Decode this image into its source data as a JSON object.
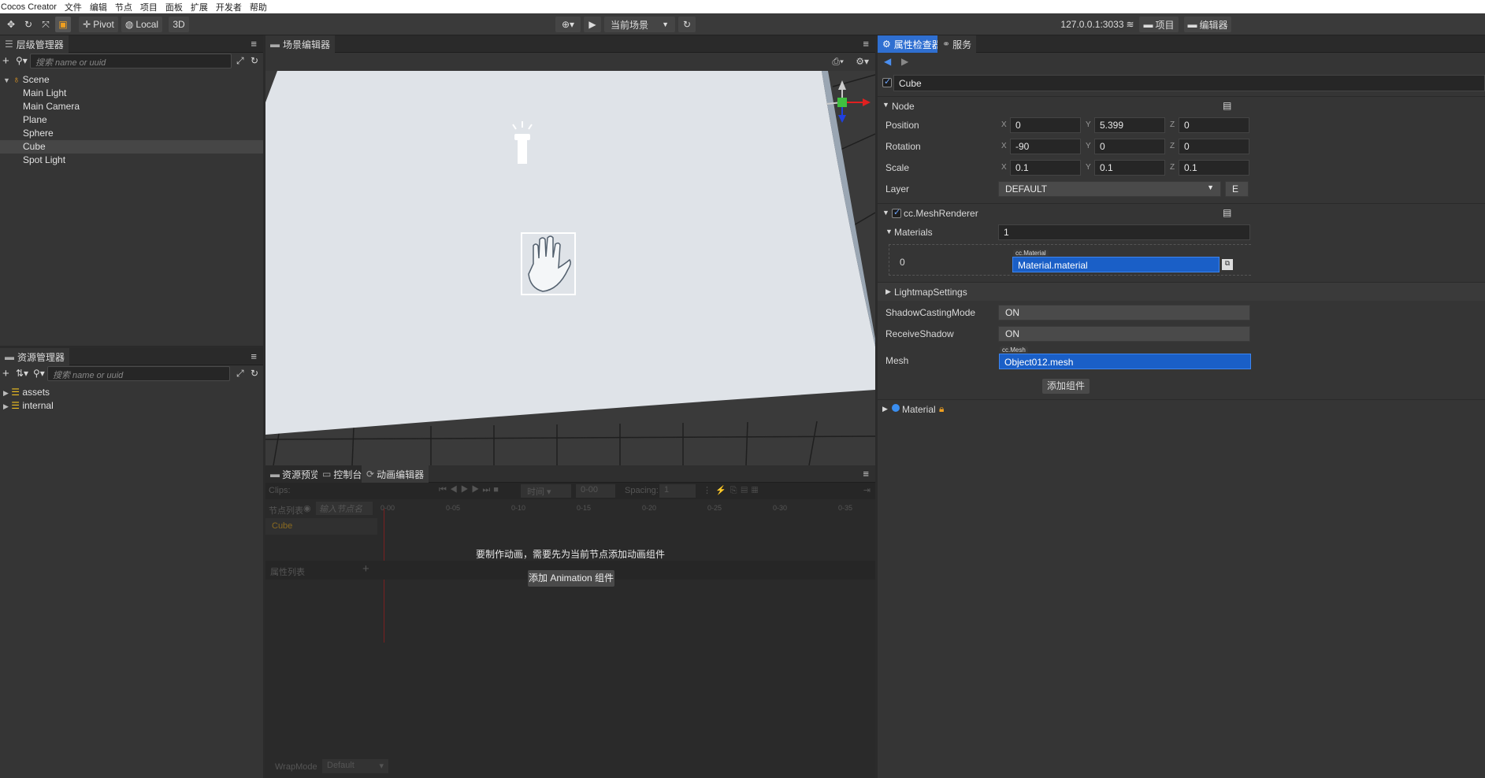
{
  "menubar": {
    "app_name": "Cocos Creator",
    "items": [
      "文件",
      "编辑",
      "节点",
      "项目",
      "面板",
      "扩展",
      "开发者",
      "帮助"
    ]
  },
  "toolbar": {
    "pivot_label": "Pivot",
    "local_label": "Local",
    "mode_3d_label": "3D",
    "scene_select": "当前场景",
    "server_address": "127.0.0.1:3033",
    "project_label": "项目",
    "editor_label": "编辑器"
  },
  "hierarchy": {
    "tab_label": "层级管理器",
    "search_placeholder": "搜索 name or uuid",
    "root": "Scene",
    "children": [
      "Main Light",
      "Main Camera",
      "Plane",
      "Sphere",
      "Cube",
      "Spot Light"
    ],
    "selected": "Cube"
  },
  "assets": {
    "tab_label": "资源管理器",
    "search_placeholder": "搜索 name or uuid",
    "items": [
      "assets",
      "internal"
    ]
  },
  "scene": {
    "tab_label": "场景编辑器"
  },
  "bottom_panel": {
    "tabs": [
      "资源预览",
      "控制台",
      "动画编辑器"
    ],
    "active_tab": "动画编辑器",
    "clips_label": "Clips:",
    "time_select": "时间",
    "time_value": "0-00",
    "spacing_label": "Spacing:",
    "spacing_value": "1",
    "node_list_label": "节点列表",
    "node_filter_placeholder": "输入节点名",
    "node_name": "Cube",
    "timeline_ticks": [
      "0-00",
      "0-05",
      "0-10",
      "0-15",
      "0-20",
      "0-25",
      "0-30",
      "0-35"
    ],
    "property_list_label": "属性列表",
    "message": "要制作动画，需要先为当前节点添加动画组件",
    "add_button": "添加 Animation 组件",
    "wrapmode_label": "WrapMode",
    "wrapmode_value": "Default"
  },
  "inspector": {
    "tabs": [
      "属性检查器",
      "服务"
    ],
    "active_tab": "属性检查器",
    "node_name": "Cube",
    "node_section": "Node",
    "position_label": "Position",
    "position": {
      "x": "0",
      "y": "5.399",
      "z": "0"
    },
    "rotation_label": "Rotation",
    "rotation": {
      "x": "-90",
      "y": "0",
      "z": "0"
    },
    "scale_label": "Scale",
    "scale": {
      "x": "0.1",
      "y": "0.1",
      "z": "0.1"
    },
    "layer_label": "Layer",
    "layer_value": "DEFAULT",
    "layer_edit_btn": "E",
    "mesh_renderer_label": "cc.MeshRenderer",
    "materials_label": "Materials",
    "materials_count": "1",
    "material_index": "0",
    "material_type_tag": "cc.Material",
    "material_value": "Material.material",
    "lightmap_label": "LightmapSettings",
    "shadow_casting_label": "ShadowCastingMode",
    "shadow_casting_value": "ON",
    "receive_shadow_label": "ReceiveShadow",
    "receive_shadow_value": "ON",
    "mesh_label": "Mesh",
    "mesh_type_tag": "cc.Mesh",
    "mesh_value": "Object012.mesh",
    "add_component_button": "添加组件",
    "material_asset_label": "Material",
    "axis_x": "X",
    "axis_y": "Y",
    "axis_z": "Z"
  },
  "colors": {
    "accent_blue": "#2f6fd1",
    "selection_blue": "#1a5fc7",
    "panel_bg": "#353535",
    "scene_plane": "#dfe3e8"
  },
  "icons": [
    "move-icon",
    "rotate-icon",
    "scale-icon",
    "rect-icon",
    "globe-icon",
    "play-icon",
    "refresh-icon",
    "wifi-icon",
    "folder-icon",
    "search-icon",
    "add-icon",
    "flashlight-icon",
    "hand-icon",
    "gizmo-icon",
    "camera-icon",
    "gear-icon",
    "lock-icon"
  ]
}
